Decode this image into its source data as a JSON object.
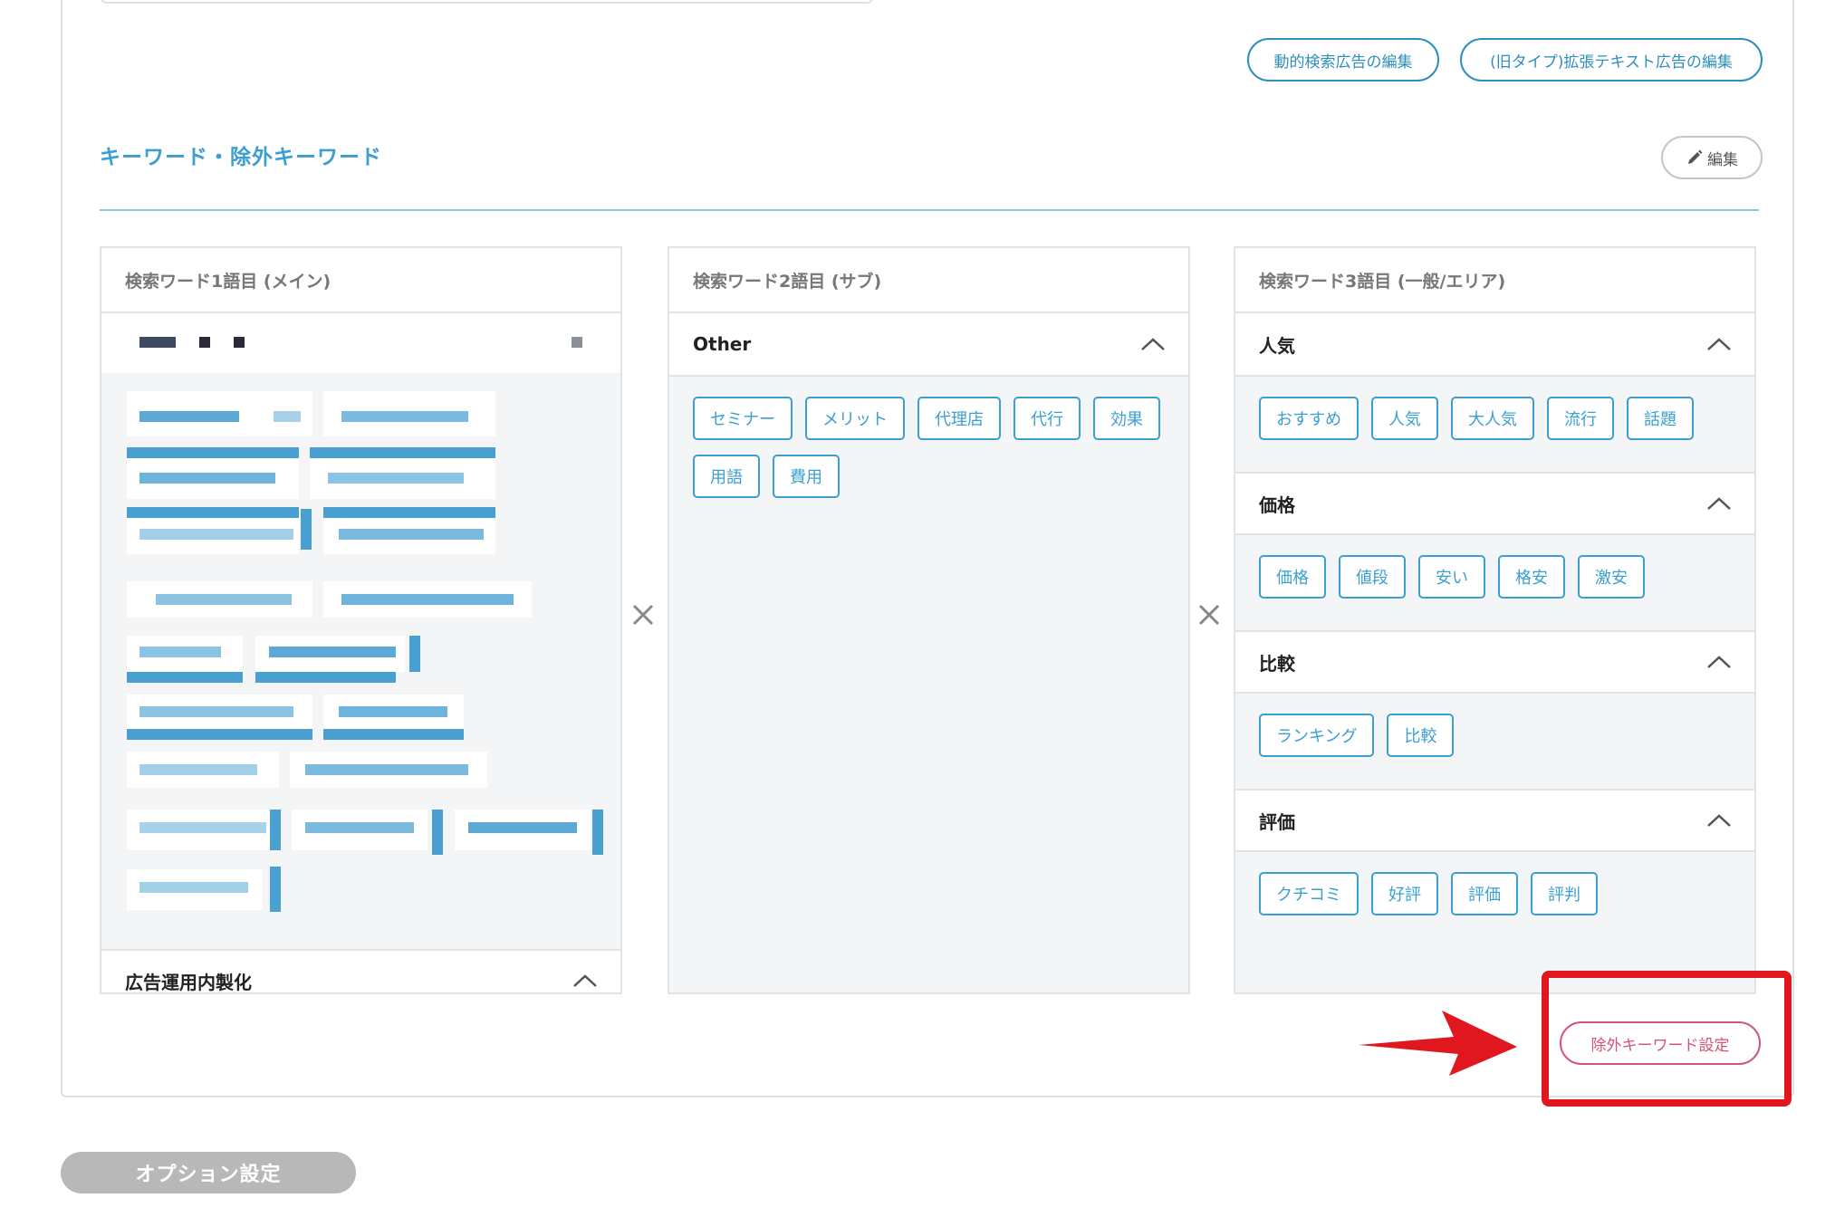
{
  "header_buttons": {
    "dsa_edit": "動的検索広告の編集",
    "eta_edit": "(旧タイプ)拡張テキスト広告の編集"
  },
  "keywords_section": {
    "title": "キーワード・除外キーワード",
    "edit_label": "編集"
  },
  "column1": {
    "title": "検索ワード1語目 (メイン)",
    "bottom_group": "広告運用内製化"
  },
  "column2": {
    "title": "検索ワード2語目 (サブ)",
    "groups": [
      {
        "name": "Other",
        "tags": [
          "セミナー",
          "メリット",
          "代理店",
          "代行",
          "効果",
          "用語",
          "費用"
        ]
      }
    ]
  },
  "column3": {
    "title": "検索ワード3語目 (一般/エリア)",
    "groups": [
      {
        "name": "人気",
        "tags": [
          "おすすめ",
          "人気",
          "大人気",
          "流行",
          "話題"
        ]
      },
      {
        "name": "価格",
        "tags": [
          "価格",
          "値段",
          "安い",
          "格安",
          "激安"
        ]
      },
      {
        "name": "比較",
        "tags": [
          "ランキング",
          "比較"
        ]
      },
      {
        "name": "評価",
        "tags": [
          "クチコミ",
          "好評",
          "評価",
          "評判"
        ]
      }
    ]
  },
  "negative_keyword_button": "除外キーワード設定",
  "option_settings_button": "オプション設定",
  "colors": {
    "accent": "#3b9fd0",
    "negative": "#d45573",
    "annotation": "#e0171e"
  }
}
